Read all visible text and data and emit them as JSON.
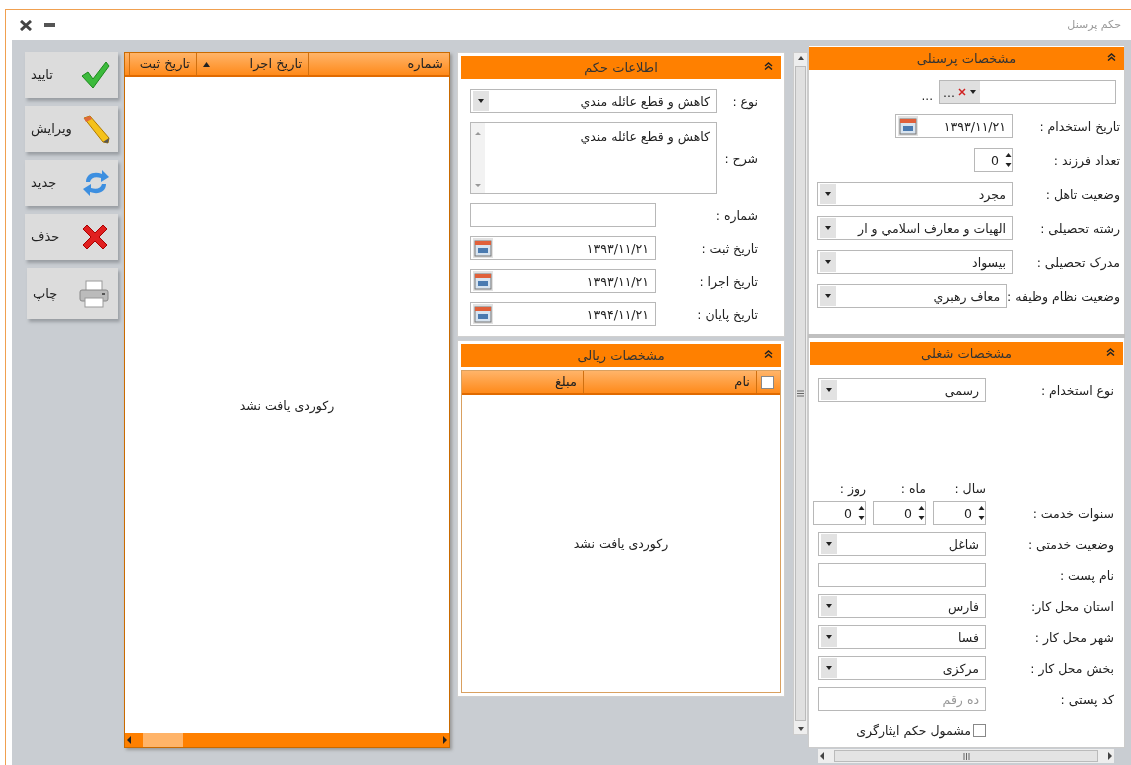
{
  "window": {
    "title": "حکم پرسنل"
  },
  "toolbar": [
    {
      "kind": "confirm",
      "label": "تایید"
    },
    {
      "kind": "edit",
      "label": "ویرایش"
    },
    {
      "kind": "new",
      "label": "جدید"
    },
    {
      "kind": "delete",
      "label": "حذف"
    },
    {
      "kind": "print",
      "label": "چاپ"
    }
  ],
  "records_grid": {
    "columns": [
      {
        "label": "شماره",
        "sorted": false
      },
      {
        "label": "تاریخ اجرا",
        "sorted": true
      },
      {
        "label": "تاریخ ثبت",
        "sorted": false
      }
    ],
    "empty_text": "رکوردی یافت نشد"
  },
  "ruling_panel": {
    "title": "اطلاعات حکم",
    "fields": [
      {
        "kind": "select",
        "label": "نوع :",
        "value": "کاهش و قطع عائله مندي"
      },
      {
        "kind": "textarea",
        "label": "شرح :",
        "value": "کاهش و قطع عائله مندي"
      },
      {
        "kind": "text",
        "label": "شماره :"
      },
      {
        "kind": "date",
        "label": "تاریخ ثبت :",
        "value": "۱۳۹۳/۱۱/۲۱"
      },
      {
        "kind": "date",
        "label": "تاریخ اجرا :",
        "value": "۱۳۹۳/۱۱/۲۱"
      },
      {
        "kind": "date",
        "label": "تاریخ پایان :",
        "value": "۱۳۹۴/۱۱/۲۱"
      }
    ]
  },
  "amounts_panel": {
    "title": "مشخصات ریالی",
    "select_all_checked": false,
    "columns": [
      "نام",
      "مبلغ"
    ],
    "empty_text": "رکوردی یافت نشد"
  },
  "personnel_panel": {
    "title": "مشخصات پرسنلی",
    "fields": [
      {
        "kind": "lookup",
        "button_label": "...",
        "trailing": "..."
      },
      {
        "kind": "date",
        "label": "تاریخ استخدام :",
        "value": "۱۳۹۳/۱۱/۲۱"
      },
      {
        "kind": "spin",
        "label": "تعداد فرزند :",
        "value": "0"
      },
      {
        "kind": "select",
        "label": "وضعیت تاهل :",
        "value": "مجرد"
      },
      {
        "kind": "select",
        "label": "رشته تحصیلی :",
        "value": "الهیات و معارف اسلامي و ار"
      },
      {
        "kind": "select",
        "label": "مدرک تحصیلی :",
        "value": "بیسواد"
      },
      {
        "kind": "select",
        "label": "وضعیت نظام وظیفه :",
        "value": "معاف رهبري"
      }
    ]
  },
  "job_panel": {
    "title": "مشخصات شغلی",
    "fields": [
      {
        "kind": "select",
        "label": "نوع استخدام :",
        "value": "رسمی"
      },
      {
        "kind": "spin_group",
        "label": "سنوات خدمت :",
        "parts": [
          {
            "unit": "سال :",
            "value": "0"
          },
          {
            "unit": "ماه :",
            "value": "0"
          },
          {
            "unit": "روز :",
            "value": "0"
          }
        ]
      },
      {
        "kind": "select",
        "label": "وضعیت خدمتی :",
        "value": "شاغل"
      },
      {
        "kind": "text",
        "label": "نام پست :"
      },
      {
        "kind": "select",
        "label": "استان محل کار:",
        "value": "فارس"
      },
      {
        "kind": "select",
        "label": "شهر محل کار :",
        "value": "فسا"
      },
      {
        "kind": "select",
        "label": "بخش محل کار :",
        "value": "مرکزی"
      },
      {
        "kind": "text",
        "label": "کد پستی :",
        "placeholder": "ده رقم"
      },
      {
        "kind": "checkbox",
        "label": "مشمول حکم ایثارگری",
        "checked": false
      }
    ]
  }
}
